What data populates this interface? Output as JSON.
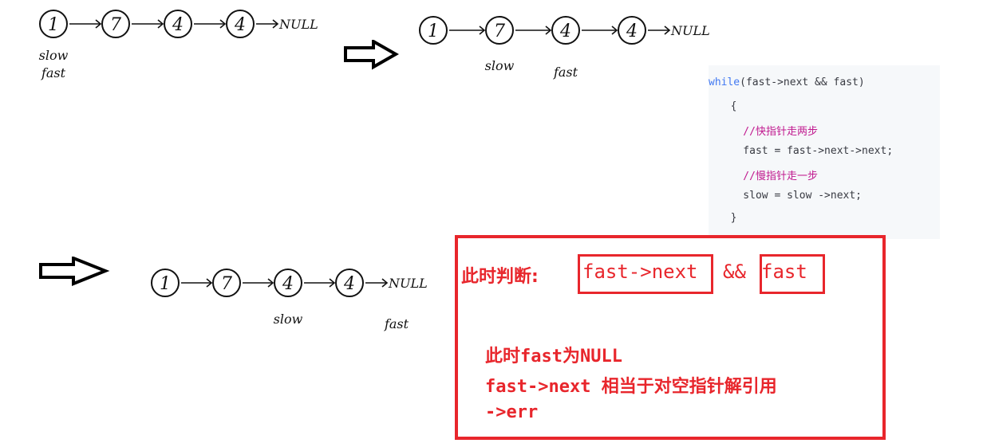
{
  "diagram1": {
    "nodes": [
      "1",
      "7",
      "4",
      "4"
    ],
    "terminal": "NULL",
    "labels": [
      {
        "text": "slow",
        "node": 0
      },
      {
        "text": "fast",
        "node": 0
      }
    ]
  },
  "diagram2": {
    "nodes": [
      "1",
      "7",
      "4",
      "4"
    ],
    "terminal": "NULL",
    "labels": [
      {
        "text": "slow",
        "node": 1
      },
      {
        "text": "fast",
        "node": 2
      }
    ]
  },
  "diagram3": {
    "nodes": [
      "1",
      "7",
      "4",
      "4"
    ],
    "terminal": "NULL",
    "labels": [
      {
        "text": "slow",
        "node": 2
      },
      {
        "text": "fast",
        "node": "null"
      }
    ]
  },
  "code": {
    "lines": [
      {
        "keyword": "while",
        "rest": "(fast->next && fast)"
      },
      {
        "text": "  {"
      },
      {
        "comment": "    //快指针走两步"
      },
      {
        "text": "    fast = fast->next->next;"
      },
      {
        "comment": "    //慢指针走一步"
      },
      {
        "text": "    slow = slow ->next;"
      },
      {
        "text": "  }"
      }
    ]
  },
  "note": {
    "judge_label": "此时判断:",
    "cond1": "fast->next",
    "op": "&&",
    "cond2": "fast",
    "line1": "此时fast为NULL",
    "line2": "fast->next 相当于对空指针解引用",
    "line3": "->err"
  },
  "colors": {
    "accent_red": "#e8262c",
    "keyword_blue": "#4078f2",
    "comment_magenta": "#c0188e",
    "code_bg": "#f6f8fa"
  }
}
